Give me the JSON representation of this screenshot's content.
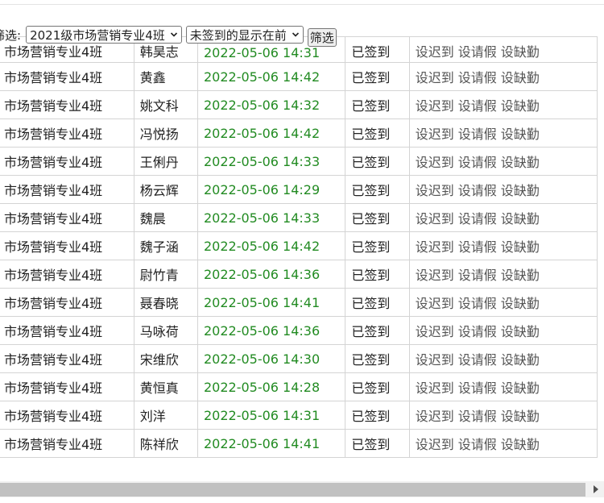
{
  "filter": {
    "label": "筛选:",
    "class_select": "2021级市场营销专业4班",
    "sort_select": "未签到的显示在前",
    "button": "筛选"
  },
  "colors": {
    "time_text": "#228b22",
    "action_text": "#555555"
  },
  "actions": [
    "设迟到",
    "设请假",
    "设缺勤"
  ],
  "rows": [
    {
      "class": "市场营销专业4班",
      "name": "韩昊志",
      "time": "2022-05-06 14:31",
      "status": "已签到"
    },
    {
      "class": "市场营销专业4班",
      "name": "黄鑫",
      "time": "2022-05-06 14:42",
      "status": "已签到"
    },
    {
      "class": "市场营销专业4班",
      "name": "姚文科",
      "time": "2022-05-06 14:32",
      "status": "已签到"
    },
    {
      "class": "市场营销专业4班",
      "name": "冯悦扬",
      "time": "2022-05-06 14:42",
      "status": "已签到"
    },
    {
      "class": "市场营销专业4班",
      "name": "王俐丹",
      "time": "2022-05-06 14:33",
      "status": "已签到"
    },
    {
      "class": "市场营销专业4班",
      "name": "杨云辉",
      "time": "2022-05-06 14:29",
      "status": "已签到"
    },
    {
      "class": "市场营销专业4班",
      "name": "魏晨",
      "time": "2022-05-06 14:33",
      "status": "已签到"
    },
    {
      "class": "市场营销专业4班",
      "name": "魏子涵",
      "time": "2022-05-06 14:42",
      "status": "已签到"
    },
    {
      "class": "市场营销专业4班",
      "name": "尉竹青",
      "time": "2022-05-06 14:36",
      "status": "已签到"
    },
    {
      "class": "市场营销专业4班",
      "name": "聂春晓",
      "time": "2022-05-06 14:41",
      "status": "已签到"
    },
    {
      "class": "市场营销专业4班",
      "name": "马咏荷",
      "time": "2022-05-06 14:36",
      "status": "已签到"
    },
    {
      "class": "市场营销专业4班",
      "name": "宋维欣",
      "time": "2022-05-06 14:30",
      "status": "已签到"
    },
    {
      "class": "市场营销专业4班",
      "name": "黄恒真",
      "time": "2022-05-06 14:28",
      "status": "已签到"
    },
    {
      "class": "市场营销专业4班",
      "name": "刘洋",
      "time": "2022-05-06 14:31",
      "status": "已签到"
    },
    {
      "class": "市场营销专业4班",
      "name": "陈祥欣",
      "time": "2022-05-06 14:41",
      "status": "已签到"
    }
  ]
}
